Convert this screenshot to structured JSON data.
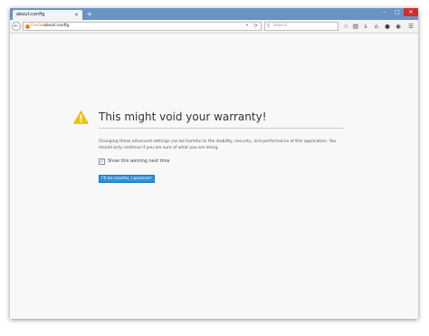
{
  "tab": {
    "title": "about:config",
    "close": "×",
    "new_tab": "+"
  },
  "window_controls": {
    "minimize": "–",
    "maximize": "□",
    "close": "✕"
  },
  "navbar": {
    "back": "←",
    "identity_label": "Firefox",
    "url": "about:config",
    "dropdown": "▾",
    "reload": "⟳",
    "search_placeholder": "Search",
    "toolbar_icons": [
      "star-icon",
      "reading-list-icon",
      "download-icon",
      "home-icon",
      "chat-icon",
      "pocket-icon",
      "menu-icon"
    ]
  },
  "warning": {
    "title": "This might void your warranty!",
    "description": "Changing these advanced settings can be harmful to the stability, security, and performance of this application. You should only continue if you are sure of what you are doing.",
    "checkbox_label": "Show this warning next time",
    "checkbox_checked": true,
    "button_label": "I'll be careful, I promise!"
  },
  "colors": {
    "accent": "#2f90d9",
    "warning_icon": "#f0c20c",
    "tab_strip": "#6a93c4",
    "firefox_orange": "#e7811f"
  }
}
